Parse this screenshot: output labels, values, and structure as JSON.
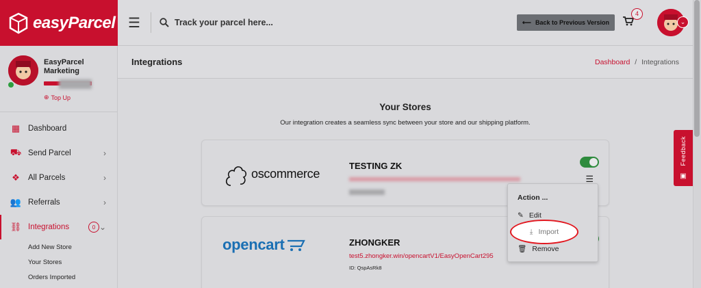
{
  "brand": {
    "name": "easyParcel"
  },
  "topbar": {
    "search_placeholder": "Track your parcel here...",
    "back_label": "Back to Previous Version",
    "cart_count": "4"
  },
  "profile": {
    "name": "EasyParcel Marketing",
    "topup": "Top Up"
  },
  "sidebar": {
    "items": [
      {
        "label": "Dashboard"
      },
      {
        "label": "Send Parcel"
      },
      {
        "label": "All Parcels"
      },
      {
        "label": "Referrals"
      },
      {
        "label": "Integrations",
        "badge": "0"
      }
    ],
    "sub_items": [
      "Add New Store",
      "Your Stores",
      "Orders Imported"
    ]
  },
  "page": {
    "title": "Integrations",
    "breadcrumb": {
      "home": "Dashboard",
      "separator": "/",
      "current": "Integrations"
    }
  },
  "section": {
    "title": "Your Stores",
    "subtitle": "Our integration creates a seamless sync between your store and our shipping platform."
  },
  "stores": [
    {
      "platform": "oscommerce",
      "name": "TESTING ZK"
    },
    {
      "platform": "opencart",
      "name": "ZHONGKER",
      "url": "test5.zhongker.win/opencartV1/EasyOpenCart295",
      "id": "ID: QspAsRk8"
    }
  ],
  "action_menu": {
    "title": "Action ...",
    "edit": "Edit",
    "import": "Import",
    "remove": "Remove"
  },
  "feedback": {
    "label": "Feedback"
  },
  "colors": {
    "brand": "#c8102e",
    "toggle_on": "#2e8b3d",
    "opencart": "#1a6fb3"
  }
}
